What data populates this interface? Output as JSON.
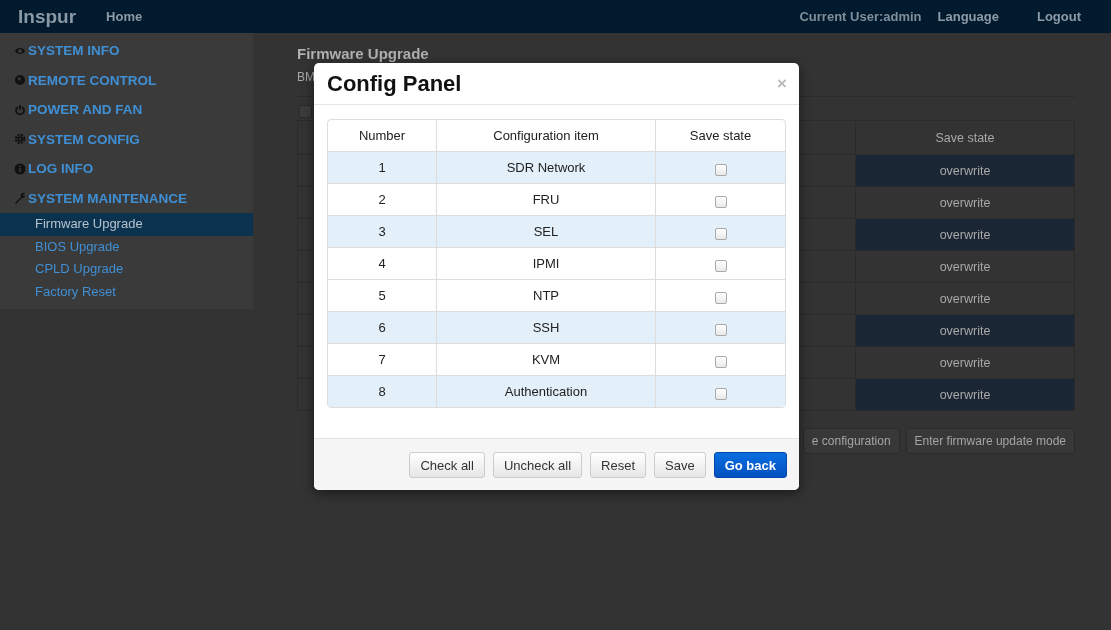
{
  "navbar": {
    "brand": "Inspur",
    "links": [
      "Home"
    ],
    "current_user": "Current User:admin",
    "language": "Language",
    "logout": "Logout"
  },
  "sidebar": {
    "sections": [
      {
        "label": "SYSTEM INFO"
      },
      {
        "label": "REMOTE CONTROL"
      },
      {
        "label": "POWER AND FAN"
      },
      {
        "label": "SYSTEM CONFIG"
      },
      {
        "label": "LOG INFO"
      },
      {
        "label": "SYSTEM MAINTENANCE",
        "children": [
          {
            "label": "Firmware Upgrade",
            "selected": true
          },
          {
            "label": "BIOS Upgrade",
            "selected": false
          },
          {
            "label": "CPLD Upgrade",
            "selected": false
          },
          {
            "label": "Factory Reset",
            "selected": false
          }
        ]
      }
    ]
  },
  "main": {
    "title": "Firmware Upgrade",
    "subtitle": "BM",
    "select_all": {
      "checked": false
    },
    "table": {
      "columns": [
        "Save state"
      ],
      "rows": [
        {
          "save_state": "overwrite",
          "highlighted": true
        },
        {
          "save_state": "overwrite",
          "highlighted": false
        },
        {
          "save_state": "overwrite",
          "highlighted": true
        },
        {
          "save_state": "overwrite",
          "highlighted": false
        },
        {
          "save_state": "overwrite",
          "highlighted": false
        },
        {
          "save_state": "overwrite",
          "highlighted": true
        },
        {
          "save_state": "overwrite",
          "highlighted": false
        },
        {
          "save_state": "overwrite",
          "highlighted": true
        }
      ]
    },
    "buttons": [
      "e configuration",
      "Enter firmware update mode"
    ]
  },
  "modal": {
    "title": "Config Panel",
    "close": "×",
    "columns": [
      "Number",
      "Configuration item",
      "Save state"
    ],
    "rows": [
      {
        "number": "1",
        "item": "SDR Network",
        "checked": false,
        "highlighted": true
      },
      {
        "number": "2",
        "item": "FRU",
        "checked": false,
        "highlighted": false
      },
      {
        "number": "3",
        "item": "SEL",
        "checked": false,
        "highlighted": true
      },
      {
        "number": "4",
        "item": "IPMI",
        "checked": false,
        "highlighted": false
      },
      {
        "number": "5",
        "item": "NTP",
        "checked": false,
        "highlighted": false
      },
      {
        "number": "6",
        "item": "SSH",
        "checked": false,
        "highlighted": true
      },
      {
        "number": "7",
        "item": "KVM",
        "checked": false,
        "highlighted": false
      },
      {
        "number": "8",
        "item": "Authentication",
        "checked": false,
        "highlighted": true
      }
    ],
    "buttons": [
      {
        "label": "Check all",
        "kind": "default"
      },
      {
        "label": "Uncheck all",
        "kind": "default"
      },
      {
        "label": "Reset",
        "kind": "default"
      },
      {
        "label": "Save",
        "kind": "default"
      },
      {
        "label": "Go back",
        "kind": "primary"
      }
    ]
  }
}
